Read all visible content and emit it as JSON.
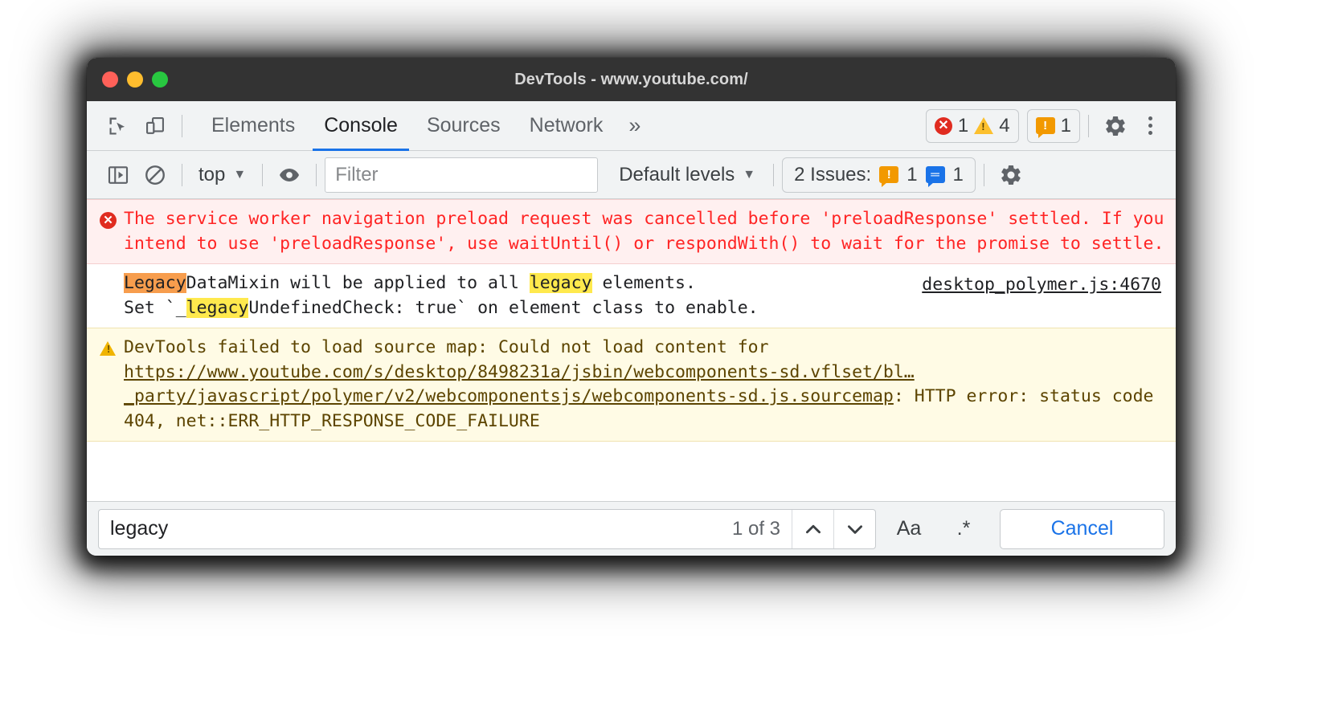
{
  "window": {
    "title": "DevTools - www.youtube.com/",
    "traffic_lights": [
      "close-red",
      "minimize-yellow",
      "maximize-green"
    ]
  },
  "tabbar": {
    "inspect_icon": "inspect-element-icon",
    "device_icon": "device-toolbar-icon",
    "tabs": [
      {
        "label": "Elements",
        "active": false
      },
      {
        "label": "Console",
        "active": true
      },
      {
        "label": "Sources",
        "active": false
      },
      {
        "label": "Network",
        "active": false
      }
    ],
    "more_tabs": "»",
    "counters": {
      "error_icon": "error-circle-icon",
      "error_count": "1",
      "warning_icon": "warning-triangle-icon",
      "warning_count": "4",
      "issue_icon": "issue-bubble-icon",
      "issue_count": "1"
    },
    "settings_icon": "gear-icon",
    "more_options_icon": "kebab-menu-icon"
  },
  "console_toolbar": {
    "sidebar_icon": "console-sidebar-icon",
    "clear_icon": "clear-console-icon",
    "context": "top",
    "context_caret": "▼",
    "eye_icon": "live-expression-eye-icon",
    "filter_placeholder": "Filter",
    "filter_value": "",
    "levels_label": "Default levels",
    "levels_caret": "▼",
    "issues_label": "2 Issues:",
    "issues_warning_count": "1",
    "issues_info_count": "1",
    "settings_icon": "console-settings-gear-icon"
  },
  "console_messages": [
    {
      "type": "error",
      "icon": "error-circle-icon",
      "text": "The service worker navigation preload request was cancelled before 'preloadResponse' settled. If you intend to use 'preloadResponse', use waitUntil() or respondWith() to wait for the promise to settle.",
      "source": ""
    },
    {
      "type": "log",
      "icon": "",
      "segments": [
        {
          "text": "Legacy",
          "highlight": "active"
        },
        {
          "text": "DataMixin will be applied to all ",
          "highlight": "none"
        },
        {
          "text": "legacy",
          "highlight": "match"
        },
        {
          "text": " elements.\nSet `_",
          "highlight": "none"
        },
        {
          "text": "legacy",
          "highlight": "match"
        },
        {
          "text": "UndefinedCheck: true` on element class to enable.",
          "highlight": "none"
        }
      ],
      "source": "desktop_polymer.js:4670"
    },
    {
      "type": "warning",
      "icon": "warning-triangle-icon",
      "prefix": "DevTools failed to load source map: Could not load content for ",
      "url": "https://www.youtube.com/s/desktop/8498231a/jsbin/webcomponents-sd.vflset/bl…_party/javascript/polymer/v2/webcomponentsjs/webcomponents-sd.js.sourcemap",
      "suffix": ": HTTP error: status code 404, net::ERR_HTTP_RESPONSE_CODE_FAILURE"
    }
  ],
  "search_bar": {
    "query": "legacy",
    "match_status": "1 of 3",
    "prev_icon": "chevron-up-icon",
    "next_icon": "chevron-down-icon",
    "match_case_label": "Aa",
    "regex_label": ".*",
    "cancel_label": "Cancel"
  },
  "colors": {
    "accent": "#1a73e8",
    "error_bg": "#fff0f0",
    "error_text": "#ff2424",
    "warning_bg": "#fffbe5",
    "warning_text": "#5c4400",
    "highlight_match": "#ffe94d",
    "highlight_active": "#f79d4d",
    "titlebar_bg": "#333333",
    "toolbar_bg": "#f1f3f4"
  }
}
